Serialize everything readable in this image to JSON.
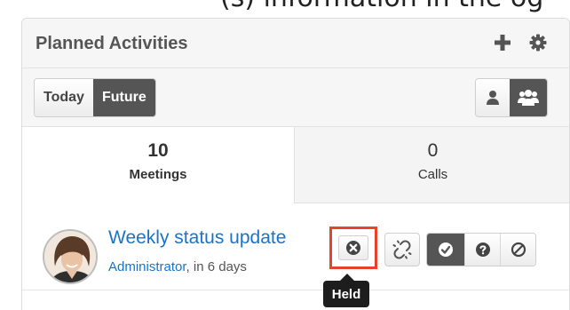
{
  "header": {
    "top_text": "(s) information in the og",
    "title": "Planned Activities",
    "add_icon": "plus-icon",
    "settings_icon": "gear-icon"
  },
  "toolbar": {
    "today_label": "Today",
    "future_label": "Future",
    "selected": "Future",
    "user_filter_icons": [
      "user-icon",
      "users-icon"
    ],
    "user_filter_selected": "users-icon"
  },
  "tabs": [
    {
      "count": "10",
      "label": "Meetings",
      "active": true
    },
    {
      "count": "0",
      "label": "Calls",
      "active": false
    }
  ],
  "activity": {
    "title": "Weekly status update",
    "assigned_user": "Administrator",
    "due": ", in 6 days",
    "status_icons": [
      "close-icon",
      "unlink-icon",
      "check-icon",
      "question-icon",
      "ban-icon"
    ],
    "active_status": "check-icon"
  },
  "tooltip": {
    "text": "Held"
  },
  "colors": {
    "accent": "#1a73c9",
    "highlight": "#e8412c",
    "active_button": "#555555"
  }
}
